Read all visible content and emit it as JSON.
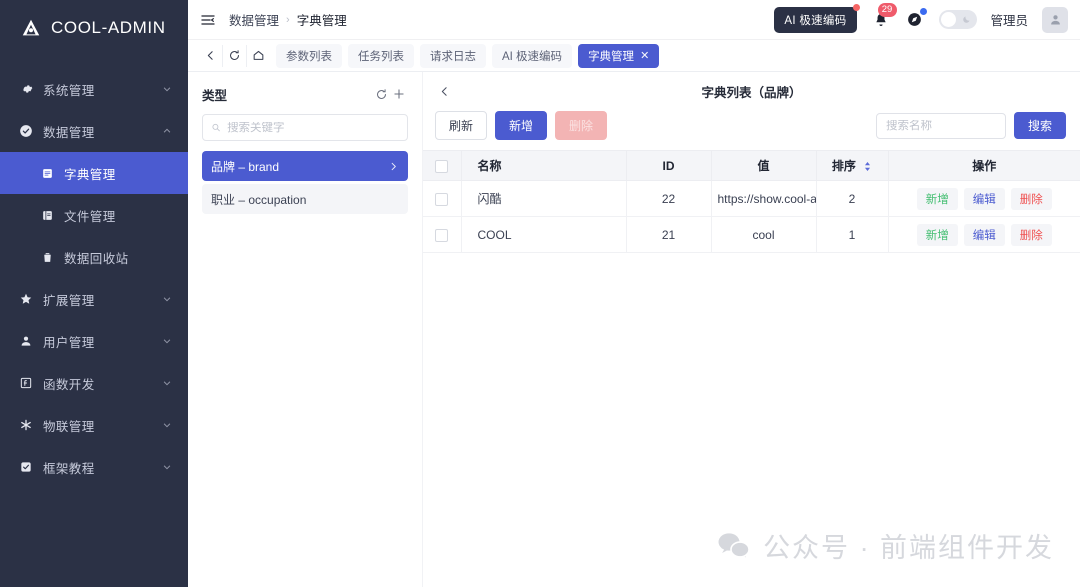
{
  "brand": {
    "name": "COOL-ADMIN",
    "logo_icon": "cool-admin-logo-icon"
  },
  "colors": {
    "sidebar_bg": "#2b3145",
    "accent": "#4b5bd0",
    "danger": "#ef5050",
    "success": "#3fbd6e",
    "badge": "#ef5b6b"
  },
  "sidebar": {
    "items": [
      {
        "label": "系统管理",
        "icon": "gear-icon",
        "level": 0,
        "expandable": true,
        "expanded": false,
        "active": false
      },
      {
        "label": "数据管理",
        "icon": "check-circle-icon",
        "level": 0,
        "expandable": true,
        "expanded": true,
        "active": false
      },
      {
        "label": "字典管理",
        "icon": "book-icon",
        "level": 1,
        "expandable": false,
        "active": true
      },
      {
        "label": "文件管理",
        "icon": "file-icon",
        "level": 1,
        "expandable": false,
        "active": false
      },
      {
        "label": "数据回收站",
        "icon": "trash-icon",
        "level": 1,
        "expandable": false,
        "active": false
      },
      {
        "label": "扩展管理",
        "icon": "star-icon",
        "level": 0,
        "expandable": true,
        "expanded": false,
        "active": false
      },
      {
        "label": "用户管理",
        "icon": "user-icon",
        "level": 0,
        "expandable": true,
        "expanded": false,
        "active": false
      },
      {
        "label": "函数开发",
        "icon": "function-icon",
        "level": 0,
        "expandable": true,
        "expanded": false,
        "active": false
      },
      {
        "label": "物联管理",
        "icon": "asterisk-icon",
        "level": 0,
        "expandable": true,
        "expanded": false,
        "active": false
      },
      {
        "label": "框架教程",
        "icon": "check-square-icon",
        "level": 0,
        "expandable": true,
        "expanded": false,
        "active": false
      }
    ]
  },
  "topbar": {
    "menu_icon": "hamburger-collapse-icon",
    "breadcrumb": {
      "parent": "数据管理",
      "separator": "›",
      "current": "字典管理"
    },
    "ai_button": "AI 极速编码",
    "notification_icon": "bell-icon",
    "notification_count": "29",
    "globe_icon": "compass-icon",
    "theme_toggle": "theme-toggle",
    "user_name": "管理员",
    "avatar_icon": "user-avatar-icon"
  },
  "tabbar": {
    "nav": [
      {
        "icon": "chevron-left-icon",
        "name": "tab-nav-back"
      },
      {
        "icon": "refresh-icon",
        "name": "tab-nav-refresh"
      },
      {
        "icon": "home-icon",
        "name": "tab-nav-home"
      }
    ],
    "tabs": [
      {
        "label": "参数列表",
        "active": false,
        "closable": false
      },
      {
        "label": "任务列表",
        "active": false,
        "closable": false
      },
      {
        "label": "请求日志",
        "active": false,
        "closable": false
      },
      {
        "label": "AI 极速编码",
        "active": false,
        "closable": false
      },
      {
        "label": "字典管理",
        "active": true,
        "closable": true,
        "close_icon": "close-icon"
      }
    ]
  },
  "type_panel": {
    "title": "类型",
    "refresh_icon": "refresh-icon",
    "add_icon": "plus-icon",
    "search_placeholder": "搜索关键字",
    "search_value": "",
    "search_icon": "search-icon",
    "items": [
      {
        "label": "品牌 – brand",
        "active": true,
        "chevron_icon": "chevron-right-icon"
      },
      {
        "label": "职业 – occupation",
        "active": false
      }
    ]
  },
  "main": {
    "collapse_icon": "chevron-left-icon",
    "title": "字典列表（品牌）",
    "toolbar": {
      "refresh_label": "刷新",
      "add_label": "新增",
      "delete_label": "删除",
      "search_placeholder": "搜索名称",
      "search_value": "",
      "search_button": "搜索"
    },
    "table": {
      "columns": [
        {
          "key": "checkbox",
          "label": ""
        },
        {
          "key": "name",
          "label": "名称"
        },
        {
          "key": "id",
          "label": "ID"
        },
        {
          "key": "value",
          "label": "值"
        },
        {
          "key": "sort",
          "label": "排序",
          "sortable": true,
          "sort_icon": "sort-arrows-icon"
        },
        {
          "key": "ops",
          "label": "操作"
        }
      ],
      "rows": [
        {
          "name": "闪酷",
          "id": "22",
          "value": "https://show.cool-adm",
          "sort": "2"
        },
        {
          "name": "COOL",
          "id": "21",
          "value": "cool",
          "sort": "1"
        }
      ],
      "row_actions": [
        {
          "label": "新增",
          "style": "add"
        },
        {
          "label": "编辑",
          "style": "edit"
        },
        {
          "label": "删除",
          "style": "del"
        }
      ]
    }
  },
  "watermark": {
    "icon": "wechat-icon",
    "text": "公众号 · 前端组件开发"
  }
}
